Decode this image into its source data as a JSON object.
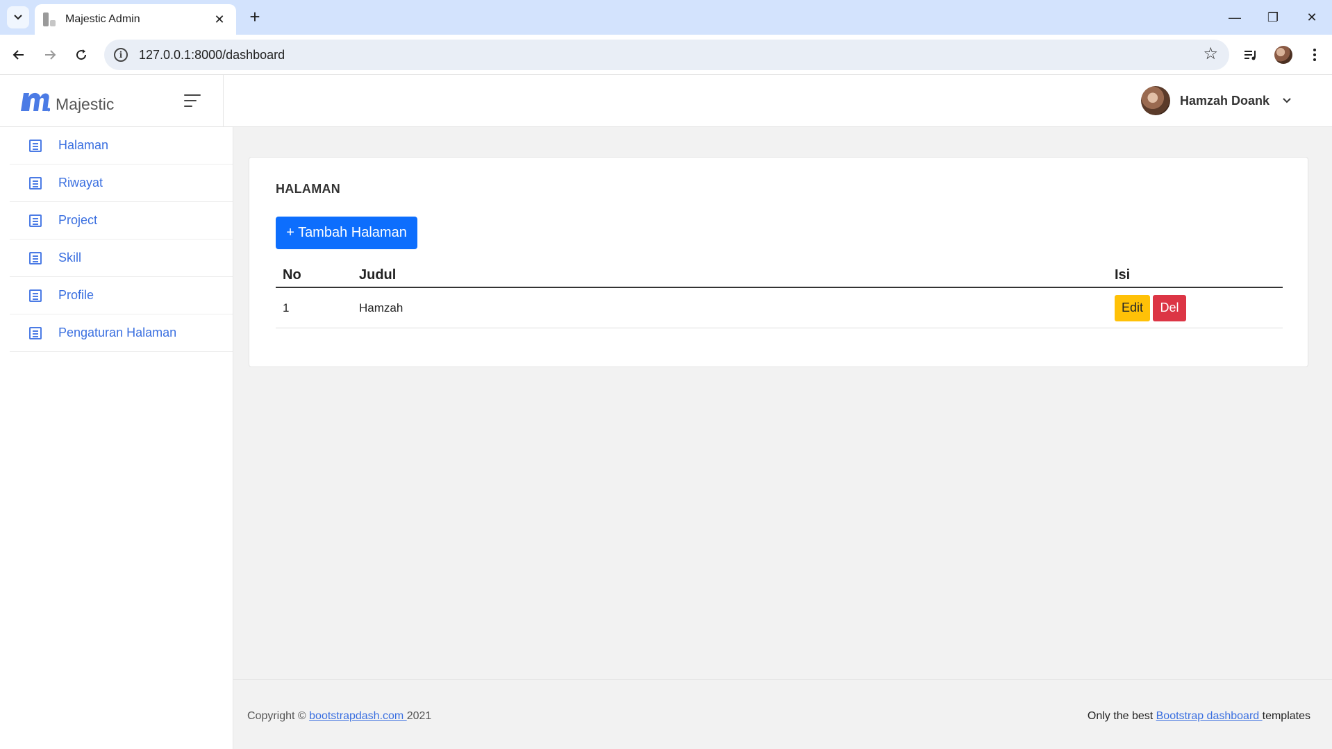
{
  "browser": {
    "tab_title": "Majestic Admin",
    "tab_close": "✕",
    "new_tab": "+",
    "url": "127.0.0.1:8000/dashboard",
    "window_controls": {
      "minimize": "—",
      "restore": "❐",
      "close": "✕"
    }
  },
  "app": {
    "brand": "Majestic",
    "user_name": "Hamzah Doank",
    "brand_color": "#4b7be5"
  },
  "sidebar": {
    "items": [
      {
        "label": "Halaman",
        "icon": "document-icon"
      },
      {
        "label": "Riwayat",
        "icon": "document-icon"
      },
      {
        "label": "Project",
        "icon": "document-icon"
      },
      {
        "label": "Skill",
        "icon": "document-icon"
      },
      {
        "label": "Profile",
        "icon": "document-icon"
      },
      {
        "label": "Pengaturan Halaman",
        "icon": "document-icon"
      }
    ]
  },
  "main": {
    "card_title": "HALAMAN",
    "add_button": "+ Tambah Halaman",
    "table": {
      "headers": [
        "No",
        "Judul",
        "Isi"
      ],
      "rows": [
        {
          "no": "1",
          "judul": "Hamzah",
          "edit_label": "Edit",
          "delete_label": "Del"
        }
      ]
    }
  },
  "footer": {
    "copyright_prefix": "Copyright © ",
    "copyright_link": "bootstrapdash.com ",
    "copyright_year": "2021",
    "right_prefix": "Only the best ",
    "right_link": "Bootstrap dashboard ",
    "right_suffix": "templates"
  },
  "colors": {
    "primary_button": "#0d6efd",
    "edit_button": "#ffc107",
    "delete_button": "#dc3545",
    "sidebar_link": "#3a6fe0"
  }
}
